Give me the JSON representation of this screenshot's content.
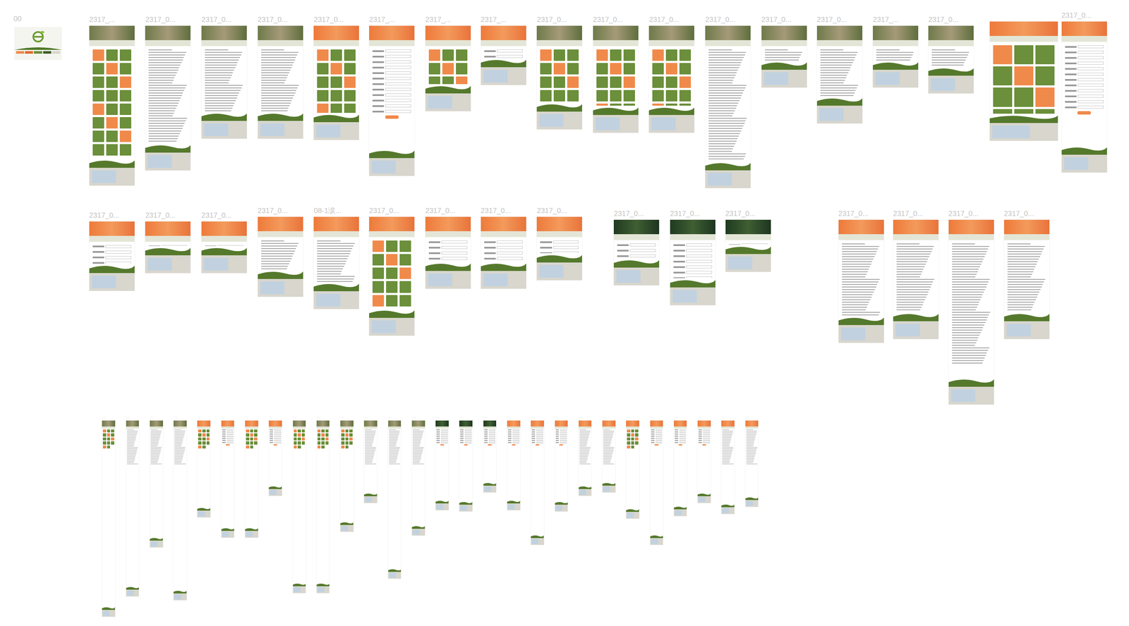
{
  "canvas": {
    "logo_frame": {
      "label": "00"
    },
    "artboards": [
      {
        "label": "2317_...",
        "header": "photo",
        "body": "grid"
      },
      {
        "label": "2317_0...",
        "header": "photo",
        "body": "text"
      },
      {
        "label": "2317_0...",
        "header": "photo",
        "body": "text"
      },
      {
        "label": "2317_0...",
        "header": "photo",
        "body": "text"
      },
      {
        "label": "2317_0...",
        "header": "orange",
        "body": "grid"
      },
      {
        "label": "2317_...",
        "header": "orange",
        "body": "form"
      },
      {
        "label": "2317_...",
        "header": "orange",
        "body": "grid"
      },
      {
        "label": "2317_...",
        "header": "orange",
        "body": "form"
      },
      {
        "label": "2317_0...",
        "header": "photo",
        "body": "grid"
      },
      {
        "label": "2317_0...",
        "header": "photo",
        "body": "grid"
      },
      {
        "label": "2317_0...",
        "header": "photo",
        "body": "grid"
      },
      {
        "label": "2317_0...",
        "header": "photo",
        "body": "text"
      },
      {
        "label": "2317_0...",
        "header": "photo",
        "body": "text"
      },
      {
        "label": "2317_0...",
        "header": "photo",
        "body": "text"
      },
      {
        "label": "2317_...",
        "header": "photo",
        "body": "text"
      },
      {
        "label": "2317_0...",
        "header": "photo",
        "body": "text"
      },
      {
        "label": "",
        "header": "orange",
        "body": "grid"
      },
      {
        "label": "2317_0...",
        "header": "orange",
        "body": "form"
      },
      {
        "label": "2317_0...",
        "header": "orange",
        "body": "form"
      },
      {
        "label": "2317_0...",
        "header": "orange",
        "body": "form"
      },
      {
        "label": "2317_0...",
        "header": "orange",
        "body": "form"
      },
      {
        "label": "2317_0...",
        "header": "orange",
        "body": "text"
      },
      {
        "label": "08-1涙...",
        "header": "orange",
        "body": "text"
      },
      {
        "label": "2317_0...",
        "header": "orange",
        "body": "grid"
      },
      {
        "label": "2317_0...",
        "header": "orange",
        "body": "form"
      },
      {
        "label": "2317_0...",
        "header": "orange",
        "body": "form"
      },
      {
        "label": "2317_0...",
        "header": "orange",
        "body": "form"
      },
      {
        "label": "2317_0...",
        "header": "dark",
        "body": "form"
      },
      {
        "label": "2317_0...",
        "header": "dark",
        "body": "form"
      },
      {
        "label": "2317_0...",
        "header": "dark",
        "body": "form"
      },
      {
        "label": "2317_0...",
        "header": "orange",
        "body": "text"
      },
      {
        "label": "2317_0...",
        "header": "orange",
        "body": "text"
      },
      {
        "label": "2317_0...",
        "header": "orange",
        "body": "text"
      },
      {
        "label": "2317_0...",
        "header": "orange",
        "body": "text"
      },
      {
        "label": "···",
        "header": "photo",
        "body": "grid"
      },
      {
        "label": "···",
        "header": "photo",
        "body": "text"
      },
      {
        "label": "···",
        "header": "photo",
        "body": "text"
      },
      {
        "label": "···",
        "header": "photo",
        "body": "text"
      },
      {
        "label": "···",
        "header": "orange",
        "body": "grid"
      },
      {
        "label": "···",
        "header": "orange",
        "body": "form"
      },
      {
        "label": "···",
        "header": "orange",
        "body": "grid"
      },
      {
        "label": "···",
        "header": "orange",
        "body": "form"
      },
      {
        "label": "···",
        "header": "photo",
        "body": "grid"
      },
      {
        "label": "···",
        "header": "photo",
        "body": "grid"
      },
      {
        "label": "···",
        "header": "photo",
        "body": "grid"
      },
      {
        "label": "···",
        "header": "photo",
        "body": "text"
      },
      {
        "label": "···",
        "header": "photo",
        "body": "text"
      },
      {
        "label": "···",
        "header": "photo",
        "body": "text"
      },
      {
        "label": "···",
        "header": "dark",
        "body": "form"
      },
      {
        "label": "···",
        "header": "dark",
        "body": "form"
      },
      {
        "label": "···",
        "header": "dark",
        "body": "form"
      },
      {
        "label": "···",
        "header": "orange",
        "body": "form"
      },
      {
        "label": "···",
        "header": "orange",
        "body": "form"
      },
      {
        "label": "···",
        "header": "orange",
        "body": "form"
      },
      {
        "label": "···",
        "header": "orange",
        "body": "text"
      },
      {
        "label": "···",
        "header": "orange",
        "body": "text"
      },
      {
        "label": "···",
        "header": "orange",
        "body": "grid"
      },
      {
        "label": "···",
        "header": "orange",
        "body": "form"
      },
      {
        "label": "···",
        "header": "orange",
        "body": "form"
      },
      {
        "label": "···",
        "header": "orange",
        "body": "form"
      },
      {
        "label": "···",
        "header": "orange",
        "body": "text"
      },
      {
        "label": "···",
        "header": "orange",
        "body": "text"
      }
    ]
  }
}
